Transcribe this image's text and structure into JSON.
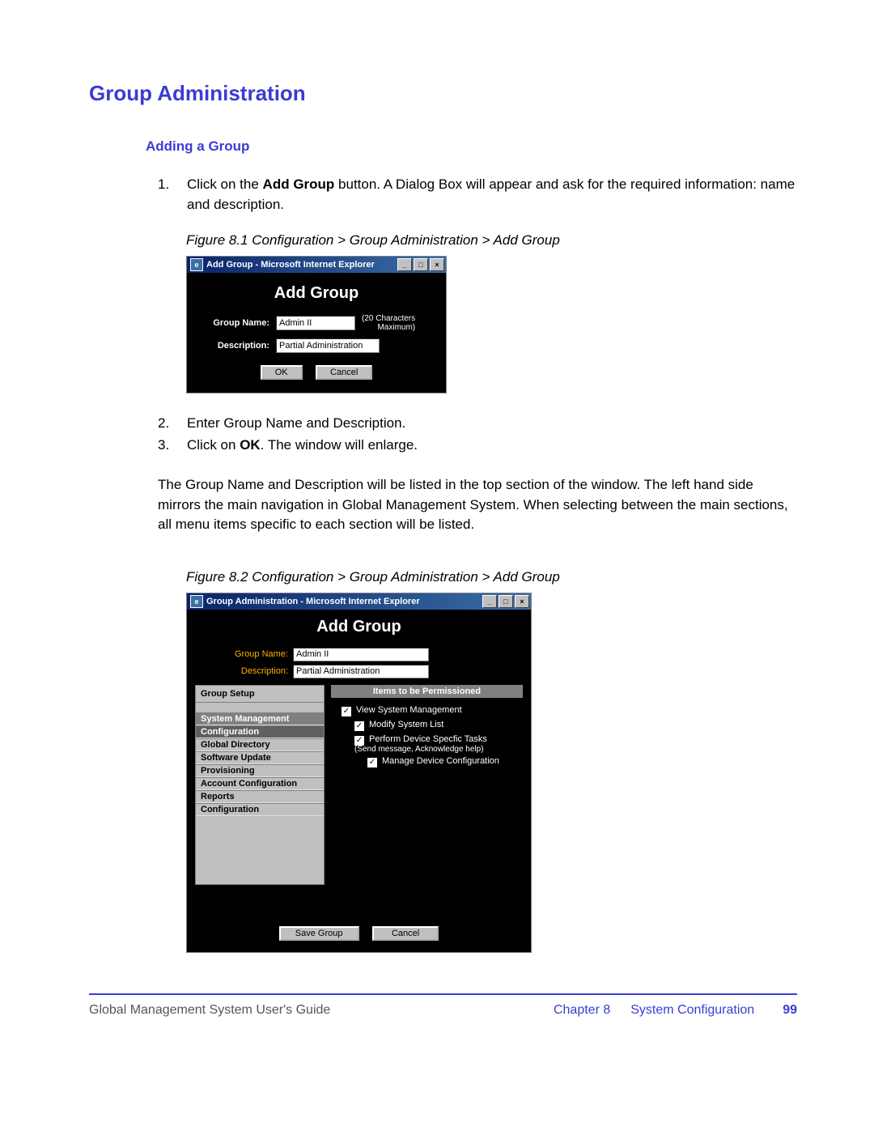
{
  "heading": "Group Administration",
  "subheading": "Adding a Group",
  "step1_pre": "Click on the ",
  "step1_bold": "Add Group",
  "step1_post": " button. A Dialog Box will appear and ask for the required information: name and description.",
  "fig1_caption": "Figure 8.1 Configuration > Group Administration > Add Group",
  "dlg1": {
    "titlebar": "Add Group - Microsoft Internet Explorer",
    "heading": "Add Group",
    "label_groupname": "Group Name:",
    "label_description": "Description:",
    "val_groupname": "Admin II",
    "val_description": "Partial Administration",
    "hint_line1": "(20 Characters",
    "hint_line2": "Maximum)",
    "btn_ok": "OK",
    "btn_cancel": "Cancel"
  },
  "step2": "Enter Group Name and Description.",
  "step3_pre": "Click on ",
  "step3_bold": "OK",
  "step3_post": ". The window will enlarge.",
  "para1": "The Group Name and Description will be listed in the top section of the window. The left hand side mirrors the main navigation in Global Management System. When selecting between the main sections, all menu items specific to each section will be listed.",
  "fig2_caption": "Figure 8.2 Configuration > Group Administration > Add Group",
  "dlg2": {
    "titlebar": "Group Administration - Microsoft Internet Explorer",
    "heading": "Add Group",
    "label_groupname": "Group Name:",
    "label_description": "Description:",
    "val_groupname": "Admin II",
    "val_description": "Partial Administration",
    "sidebar_title": "Group Setup",
    "sidebar_items": {
      "i0": "System Management",
      "i1": "Configuration",
      "i2": "Global Directory",
      "i3": "Software Update",
      "i4": "Provisioning",
      "i5": "Account Configuration",
      "i6": "Reports",
      "i7": "Configuration"
    },
    "perm_header": "Items to be Permissioned",
    "perm": {
      "p0": "View System Management",
      "p1": "Modify System List",
      "p2": "Perform Device Specfic Tasks",
      "p2s": "(Send message, Acknowledge help)",
      "p3": "Manage Device Configuration"
    },
    "btn_save": "Save Group",
    "btn_cancel": "Cancel"
  },
  "footer": {
    "left": "Global Management System User's Guide",
    "chapter": "Chapter 8",
    "section": "System Configuration",
    "page": "99"
  }
}
